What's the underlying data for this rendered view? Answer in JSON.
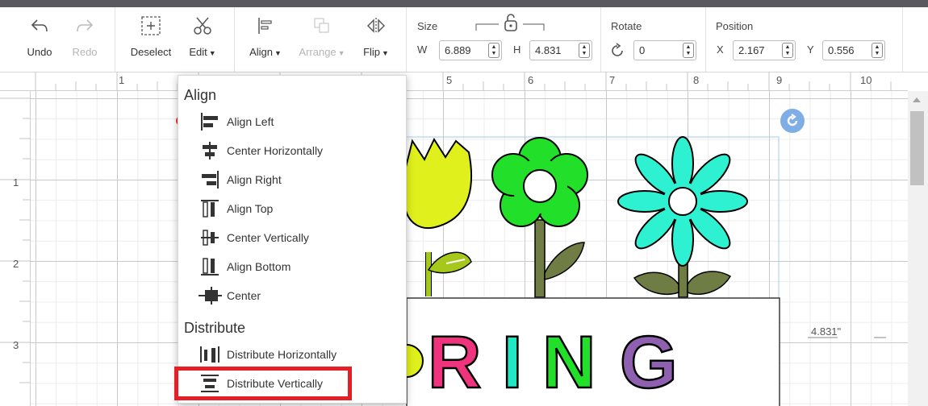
{
  "toolbar": {
    "undo_label": "Undo",
    "redo_label": "Redo",
    "deselect_label": "Deselect",
    "edit_label": "Edit",
    "align_label": "Align",
    "arrange_label": "Arrange",
    "flip_label": "Flip"
  },
  "size": {
    "title": "Size",
    "w_letter": "W",
    "w_value": "6.889",
    "h_letter": "H",
    "h_value": "4.831"
  },
  "rotate": {
    "title": "Rotate",
    "value": "0"
  },
  "position": {
    "title": "Position",
    "x_letter": "X",
    "x_value": "2.167",
    "y_letter": "Y",
    "y_value": "0.556"
  },
  "ruler": {
    "horizontal": [
      "1",
      "5",
      "6",
      "7",
      "8",
      "9",
      "10"
    ],
    "vertical": [
      "1",
      "2",
      "3"
    ]
  },
  "canvas": {
    "dimension_label": "4.831\"",
    "spring_letters": [
      "R",
      "I",
      "N",
      "G"
    ],
    "letter_colors": [
      "#f0337d",
      "#20e8c4",
      "#22e02a",
      "#8f5fb0"
    ]
  },
  "align_menu": {
    "align_title": "Align",
    "items": [
      {
        "label": "Align Left",
        "icon": "align-left-icon"
      },
      {
        "label": "Center Horizontally",
        "icon": "center-horizontally-icon"
      },
      {
        "label": "Align Right",
        "icon": "align-right-icon"
      },
      {
        "label": "Align Top",
        "icon": "align-top-icon"
      },
      {
        "label": "Center Vertically",
        "icon": "center-vertically-icon"
      },
      {
        "label": "Align Bottom",
        "icon": "align-bottom-icon"
      },
      {
        "label": "Center",
        "icon": "center-icon"
      }
    ],
    "distribute_title": "Distribute",
    "distribute_items": [
      {
        "label": "Distribute Horizontally",
        "icon": "distribute-horizontally-icon"
      },
      {
        "label": "Distribute Vertically",
        "icon": "distribute-vertically-icon"
      }
    ]
  },
  "colors": {
    "highlight": "#e51f26",
    "tulip": "#dff01c",
    "daisy_green": "#22e02a",
    "daisy_teal": "#2ef1d1",
    "stem": "#6f7d45",
    "rotate_handle": "#7faee6"
  }
}
